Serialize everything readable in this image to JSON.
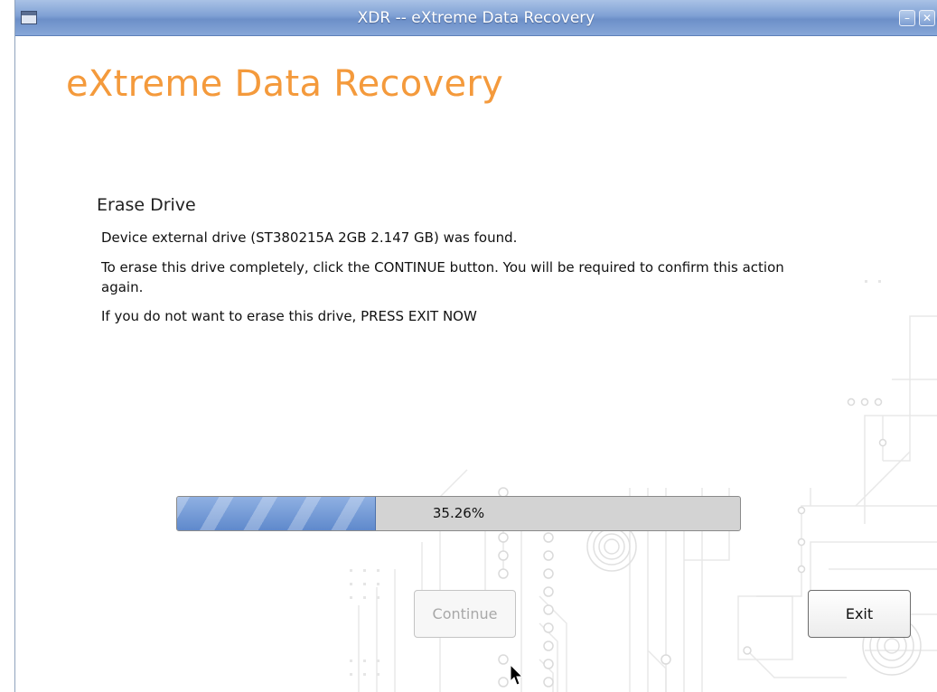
{
  "window": {
    "title": "XDR -- eXtreme Data Recovery",
    "controls": {
      "minimize_icon": "minimize-icon",
      "close_icon": "close-icon"
    }
  },
  "brand": {
    "text": "eXtreme Data Recovery",
    "color": "#f49a3c"
  },
  "section": {
    "title": "Erase Drive",
    "messages": [
      "Device external drive (ST380215A 2GB 2.147 GB) was found.",
      "To erase this drive completely, click the CONTINUE button. You will be required to confirm this action again.",
      "If you do not want to erase this drive, PRESS EXIT NOW"
    ]
  },
  "progress": {
    "label": "35.26%",
    "value": 0.3526,
    "fill_color": "#6d93d1"
  },
  "buttons": {
    "continue": {
      "label": "Continue",
      "enabled": false
    },
    "exit": {
      "label": "Exit",
      "enabled": true
    }
  }
}
